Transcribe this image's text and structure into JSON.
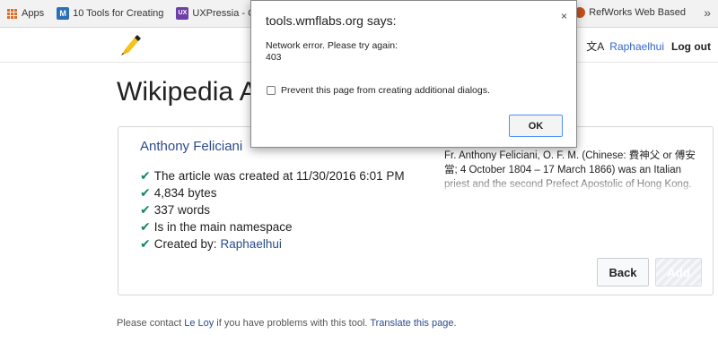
{
  "bookmarks": {
    "items": [
      {
        "label": "Apps",
        "icon": "apps-grid-icon"
      },
      {
        "label": "10 Tools for Creating",
        "icon": "m-logo-icon",
        "color": "#2c6fb6",
        "glyph": "M"
      },
      {
        "label": "UXPressia - Custo",
        "icon": "ux-logo-icon",
        "color": "#6f3fa8",
        "glyph": "UX"
      }
    ],
    "right": {
      "label": "RefWorks Web Based",
      "icon": "refworks-icon"
    },
    "more": "»"
  },
  "header": {
    "user": "Raphaelhui",
    "logout": "Log out",
    "lang_icon": "文A"
  },
  "page_title": "Wikipedia Ass",
  "article": {
    "title": "Anthony Feliciani",
    "checks": [
      "The article was created at 11/30/2016 6:01 PM",
      "4,834 bytes",
      "337 words",
      "Is in the main namespace"
    ],
    "created_by_label": "Created by:",
    "creator": "Raphaelhui",
    "check_mark": "✔",
    "summary": "Fr. Anthony Feliciani, O. F. M. (Chinese: 費神父 or 傅安當; 4 October 1804 – 17 March 1866) was an Italian priest and the second Prefect Apostolic of Hong Kong."
  },
  "buttons": {
    "back": "Back",
    "add": "Add"
  },
  "footer": {
    "prefix": "Please contact ",
    "contact": "Le Loy",
    "middle": " if you have problems with this tool. ",
    "translate": "Translate this page."
  },
  "dialog": {
    "title": "tools.wmflabs.org says:",
    "message_line1": "Network error. Please try again:",
    "message_line2": "403",
    "checkbox_label": "Prevent this page from creating additional dialogs.",
    "ok": "OK",
    "close": "×"
  }
}
